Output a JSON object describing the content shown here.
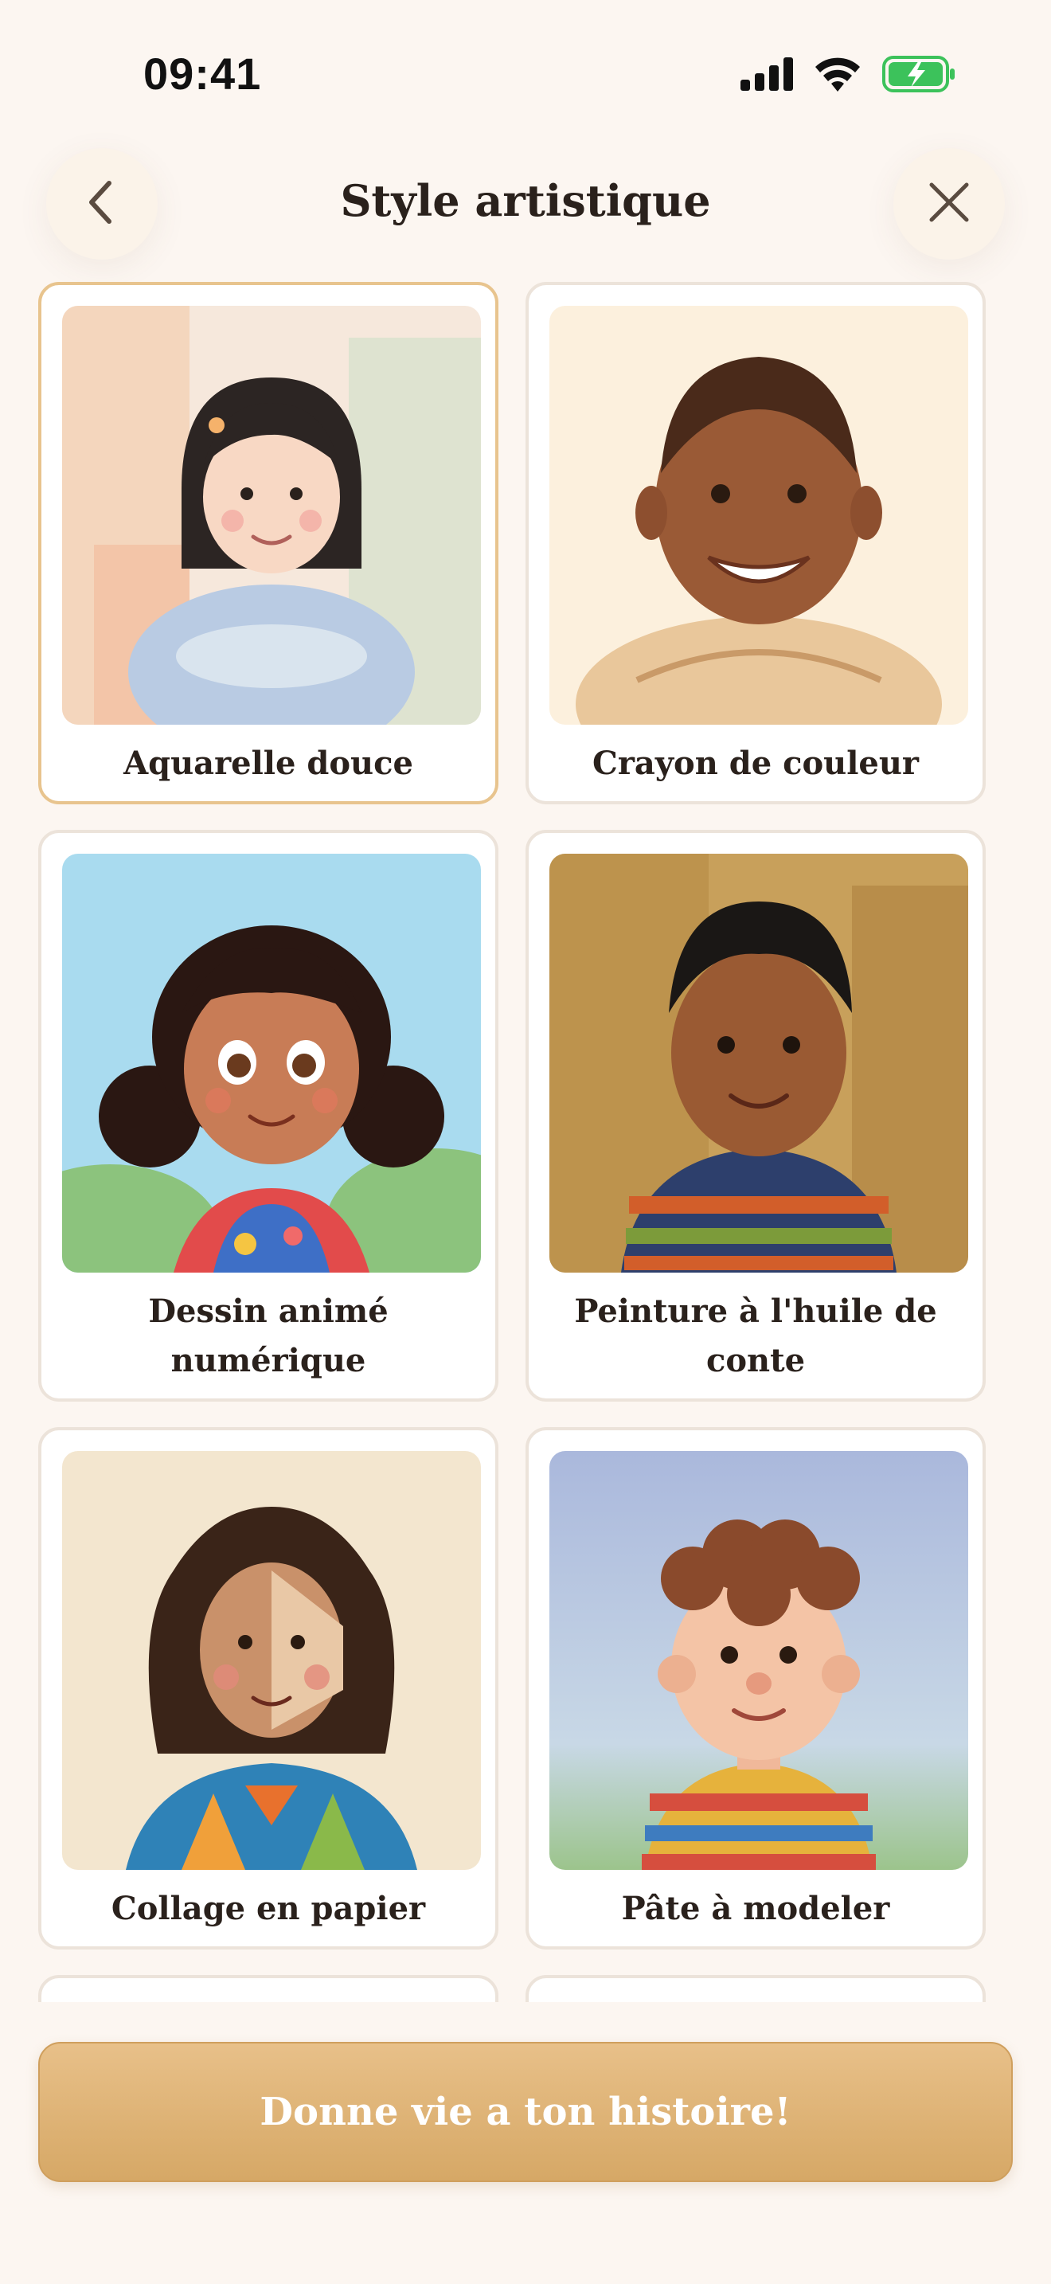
{
  "status_bar": {
    "time": "09:41",
    "icons": [
      "signal-icon",
      "wifi-icon",
      "battery-charging-icon"
    ]
  },
  "header": {
    "title": "Style artistique",
    "back_icon": "chevron-left-icon",
    "close_icon": "close-icon"
  },
  "styles": [
    {
      "label": "Aquarelle douce",
      "selected": true
    },
    {
      "label": "Crayon de couleur",
      "selected": false
    },
    {
      "label": "Dessin animé numérique",
      "selected": false
    },
    {
      "label": "Peinture à l'huile de conte",
      "selected": false
    },
    {
      "label": "Collage en papier",
      "selected": false
    },
    {
      "label": "Pâte à modeler",
      "selected": false
    }
  ],
  "cta": {
    "label": "Donne vie a ton histoire!"
  },
  "colors": {
    "background": "#fcf6f1",
    "accent": "#e2b677",
    "selected_border": "#e8c48e",
    "text": "#2a211c"
  }
}
